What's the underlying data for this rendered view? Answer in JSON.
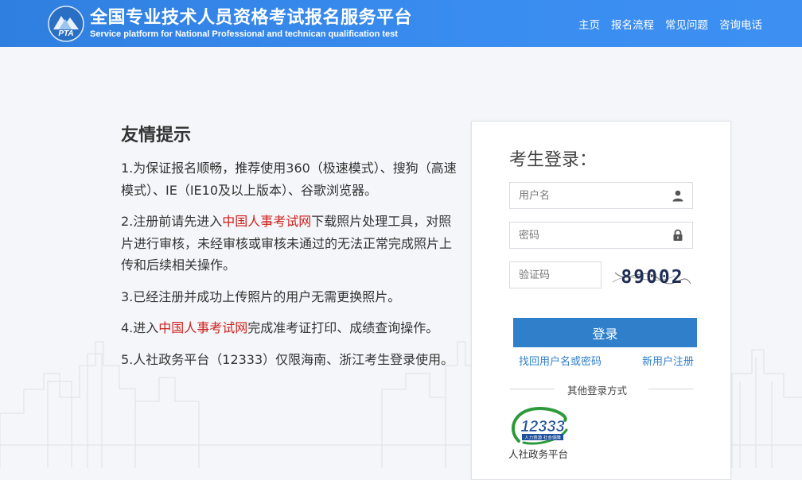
{
  "header": {
    "title_cn": "全国专业技术人员资格考试报名服务平台",
    "title_en": "Service platform for National Professional and technican qualification test",
    "logo_text": "PTA",
    "nav": [
      "主页",
      "报名流程",
      "常见问题",
      "咨询电话"
    ]
  },
  "tips": {
    "title": "友情提示",
    "items": [
      {
        "pre": "1.为保证报名顺畅，推荐使用360（极速模式）、搜狗（高速模式）、IE（IE10及以上版本）、谷歌浏览器。",
        "link": "",
        "post": ""
      },
      {
        "pre": "2.注册前请先进入",
        "link": "中国人事考试网",
        "post": "下载照片处理工具，对照片进行审核，未经审核或审核未通过的无法正常完成照片上传和后续相关操作。"
      },
      {
        "pre": "3.已经注册并成功上传照片的用户无需更换照片。",
        "link": "",
        "post": ""
      },
      {
        "pre": "4.进入",
        "link": "中国人事考试网",
        "post": "完成准考证打印、成绩查询操作。"
      },
      {
        "pre": "5.人社政务平台（12333）仅限海南、浙江考生登录使用。",
        "link": "",
        "post": ""
      }
    ]
  },
  "login": {
    "title": "考生登录：",
    "username_placeholder": "用户名",
    "password_placeholder": "密码",
    "captcha_placeholder": "验证码",
    "captcha_text": "89002",
    "submit_label": "登录",
    "forgot_link": "找回用户名或密码",
    "register_link": "新用户注册",
    "other_login_label": "其他登录方式",
    "platform_number": "12333",
    "platform_tag": "人力资源 社会保障",
    "platform_label": "人社政务平台"
  },
  "colors": {
    "header_blue": "#3a8df0",
    "button_blue": "#2f7fcb",
    "link_red": "#d0201d"
  }
}
